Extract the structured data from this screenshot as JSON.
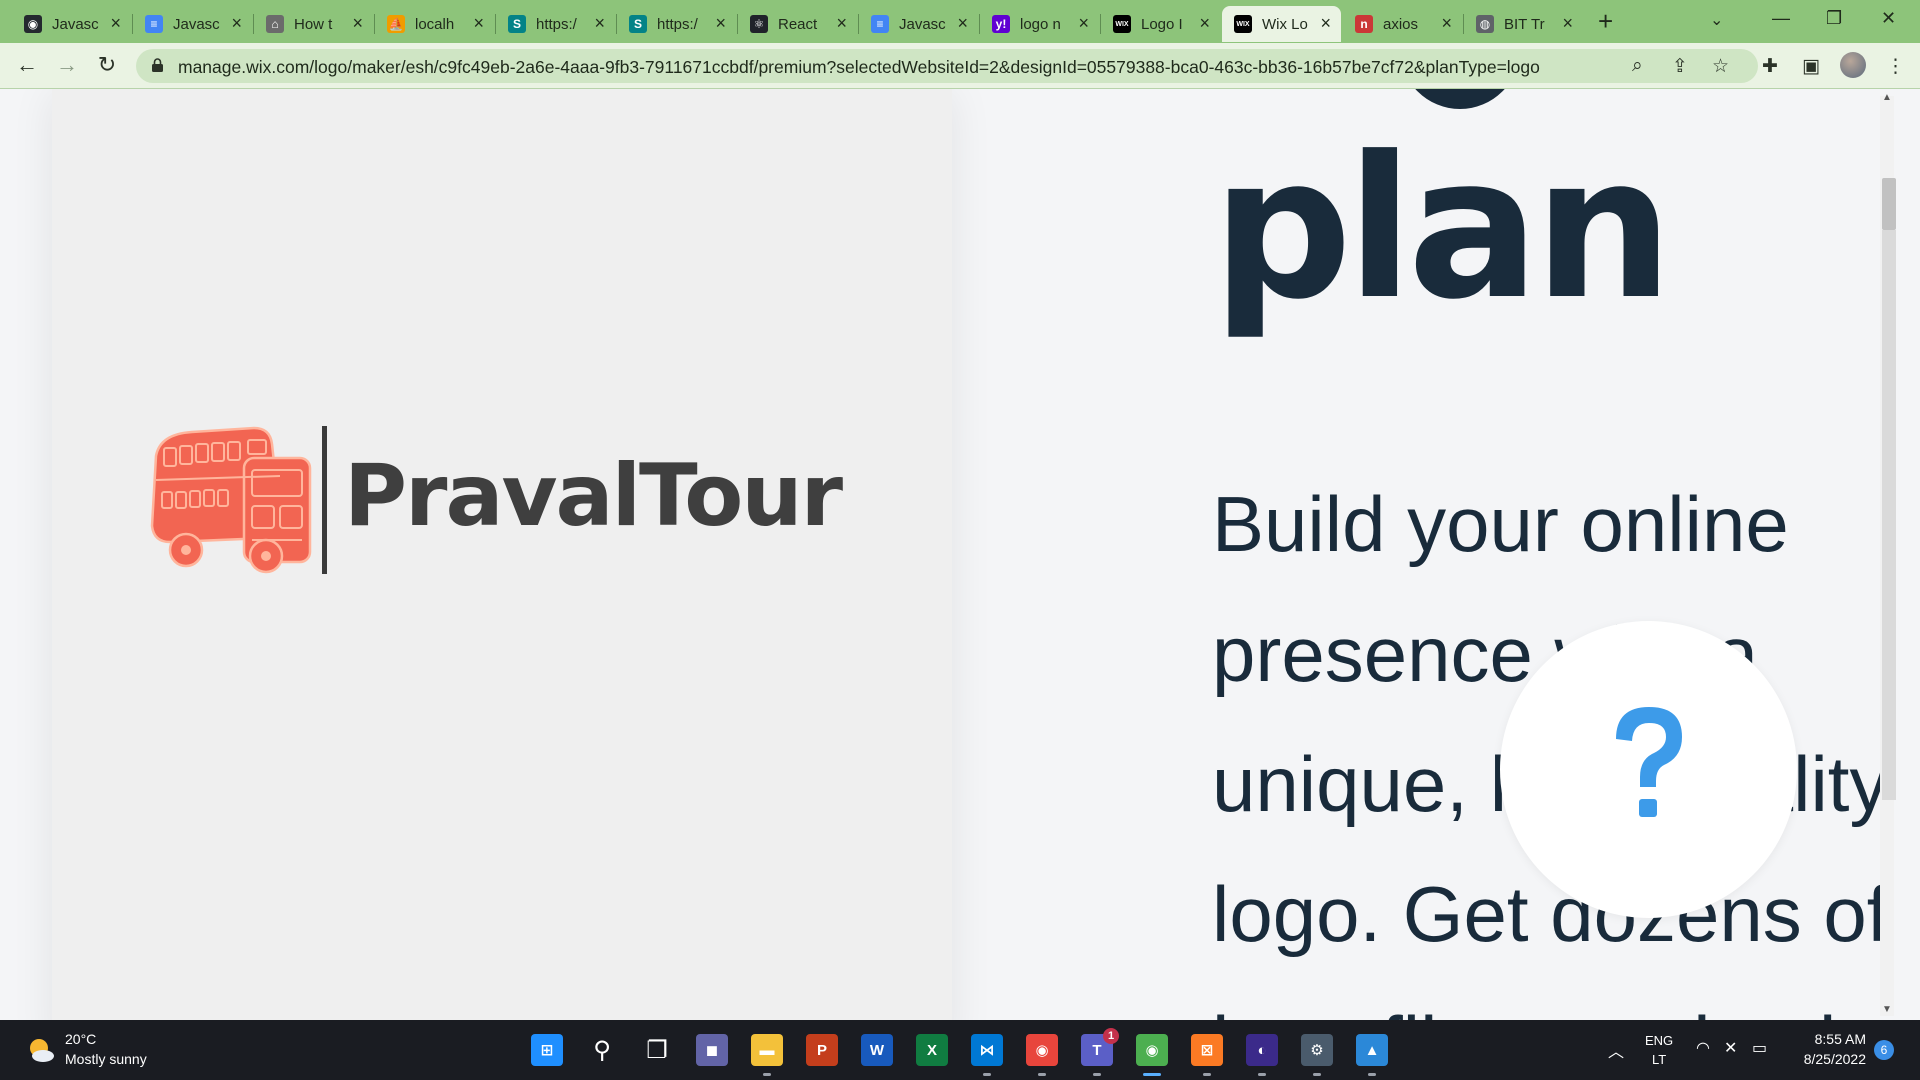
{
  "colors": {
    "tabstrip": "#8dc47a",
    "toolbar": "#eaf3e3",
    "heading": "#192b3b",
    "logo_bus": "#f26552",
    "help_icon": "#3d9be9",
    "taskbar": "#1a1c22"
  },
  "browser": {
    "tabs": [
      {
        "label": "Javasc",
        "favicon": "github-icon",
        "fav_color": "#24292f",
        "fav_glyph": "◉"
      },
      {
        "label": "Javasc",
        "favicon": "google-docs-icon",
        "fav_color": "#4285f4",
        "fav_glyph": "≡"
      },
      {
        "label": "How t",
        "favicon": "site-icon",
        "fav_color": "#6b6b6b",
        "fav_glyph": "⌂"
      },
      {
        "label": "localh",
        "favicon": "phpmyadmin-icon",
        "fav_color": "#f09c00",
        "fav_glyph": "⛵"
      },
      {
        "label": "https:/",
        "favicon": "sharepoint-icon",
        "fav_color": "#038387",
        "fav_glyph": "S"
      },
      {
        "label": "https:/",
        "favicon": "sharepoint-icon",
        "fav_color": "#038387",
        "fav_glyph": "S"
      },
      {
        "label": "React",
        "favicon": "react-icon",
        "fav_color": "#20232a",
        "fav_glyph": "⚛"
      },
      {
        "label": "Javasc",
        "favicon": "google-docs-icon",
        "fav_color": "#4285f4",
        "fav_glyph": "≡"
      },
      {
        "label": "logo n",
        "favicon": "yahoo-icon",
        "fav_color": "#6001d2",
        "fav_glyph": "y!"
      },
      {
        "label": "Logo I",
        "favicon": "wix-icon",
        "fav_color": "#000000",
        "fav_glyph": "WIX"
      },
      {
        "label": "Wix Lo",
        "favicon": "wix-icon",
        "fav_color": "#000000",
        "fav_glyph": "WIX",
        "active": true
      },
      {
        "label": "axios",
        "favicon": "npm-icon",
        "fav_color": "#cb3837",
        "fav_glyph": "n"
      },
      {
        "label": "BIT Tr",
        "favicon": "globe-icon",
        "fav_color": "#5f6368",
        "fav_glyph": "◍"
      }
    ],
    "url": "manage.wix.com/logo/maker/esh/c9fc49eb-2a6e-4aaa-9fb3-7911671ccbdf/premium?selectedWebsiteId=2&designId=05579388-bca0-463c-bb36-16b57be7cf72&planType=logo"
  },
  "page": {
    "brand_name": "PravalTour",
    "hero_title": "plan",
    "hero_lines": [
      "Build your online",
      "presence with a",
      "unique, high-quality",
      "logo. Get dozens of",
      "logo files presized"
    ],
    "help_glyph": "?"
  },
  "taskbar": {
    "weather_temp": "20°C",
    "weather_desc": "Mostly sunny",
    "apps": [
      {
        "name": "start-icon",
        "glyph": "⊞",
        "color": "#1f8fff"
      },
      {
        "name": "search-icon",
        "glyph": "⚲",
        "color": "transparent"
      },
      {
        "name": "task-view-icon",
        "glyph": "❐",
        "color": "transparent"
      },
      {
        "name": "chat-icon",
        "glyph": "◼",
        "color": "#6264a7"
      },
      {
        "name": "file-explorer-icon",
        "glyph": "▬",
        "color": "#f3c13a"
      },
      {
        "name": "powerpoint-icon",
        "glyph": "P",
        "color": "#c43e1c"
      },
      {
        "name": "word-icon",
        "glyph": "W",
        "color": "#185abd"
      },
      {
        "name": "excel-icon",
        "glyph": "X",
        "color": "#107c41"
      },
      {
        "name": "vscode-icon",
        "glyph": "⋈",
        "color": "#0078d4"
      },
      {
        "name": "chrome-icon",
        "glyph": "◉",
        "color": "#e8453c"
      },
      {
        "name": "teams-icon",
        "glyph": "T",
        "color": "#5b5fc7"
      },
      {
        "name": "chrome-profile-icon",
        "glyph": "◉",
        "color": "#4caf50"
      },
      {
        "name": "xampp-icon",
        "glyph": "⊠",
        "color": "#fb7a24"
      },
      {
        "name": "eclipse-icon",
        "glyph": "◐",
        "color": "#3b2a8a"
      },
      {
        "name": "settings-icon",
        "glyph": "⚙",
        "color": "#4a5b6c"
      },
      {
        "name": "photos-icon",
        "glyph": "▲",
        "color": "#2b88d8"
      }
    ],
    "teams_badge": "1",
    "lang_top": "ENG",
    "lang_bottom": "LT",
    "time": "8:55 AM",
    "date": "8/25/2022",
    "notifications": "6"
  }
}
